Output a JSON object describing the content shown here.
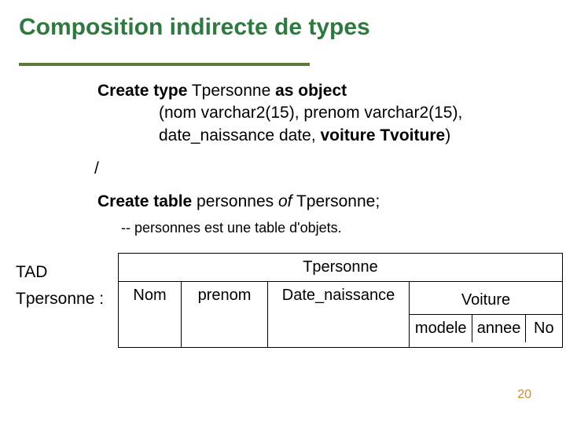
{
  "title": "Composition indirecte de types",
  "code": {
    "l1a": "Create type",
    "l1b": " Tpersonne ",
    "l1c": "as object",
    "l2": "(nom varchar2(15), prenom varchar2(15),",
    "l3a": "date_naissance date, ",
    "l3b": "voiture Tvoiture",
    "l3c": ")",
    "slash": "/",
    "l4a": "Create table",
    "l4b": " personnes ",
    "l4c": "of",
    "l4d": " Tpersonne;",
    "comment": "-- personnes est une table d'objets."
  },
  "diagram": {
    "tad": "TAD",
    "typename": "Tpersonne :",
    "header": "Tpersonne",
    "cols": {
      "nom": "Nom",
      "prenom": "prenom",
      "date": "Date_naissance",
      "voiture": "Voiture",
      "modele": "modele",
      "annee": "annee",
      "no": "No"
    }
  },
  "page": "20"
}
